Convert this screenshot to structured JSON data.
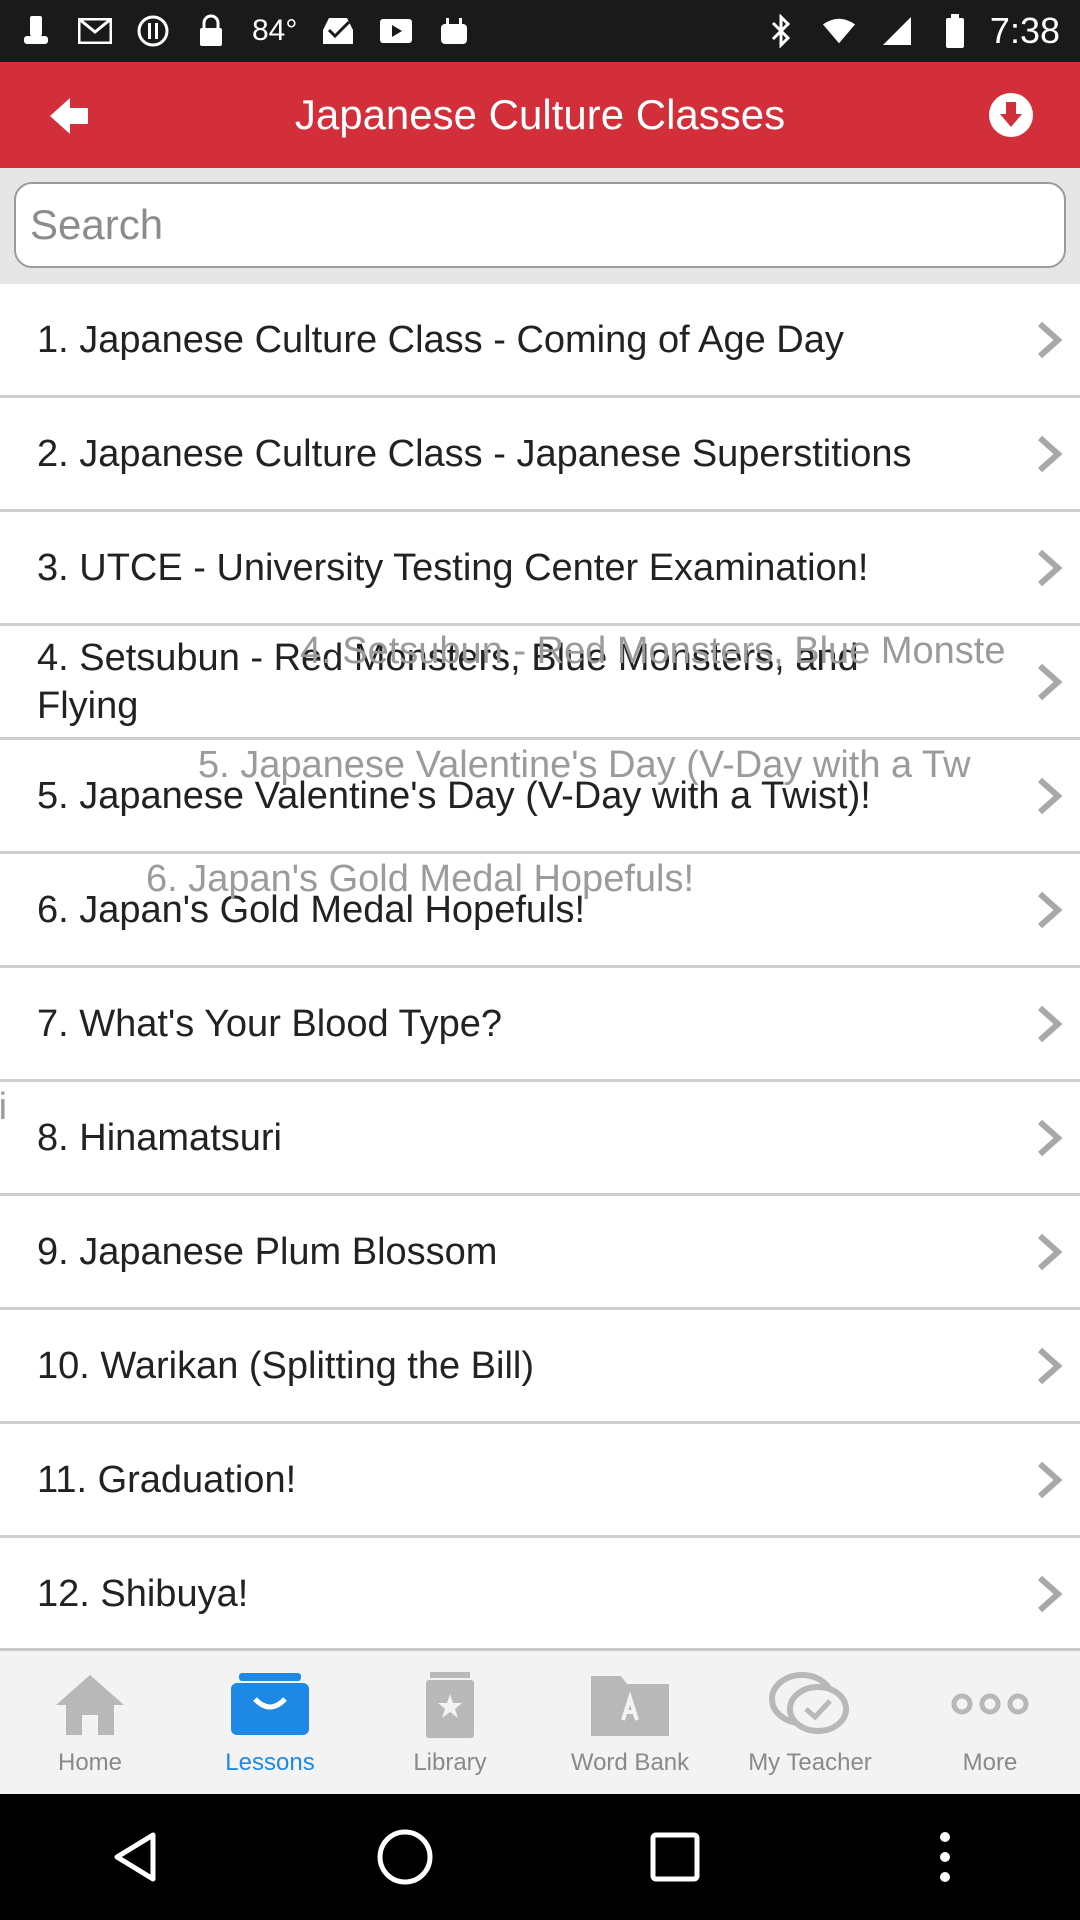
{
  "status_bar": {
    "temperature": "84°",
    "time": "7:38"
  },
  "header": {
    "title": "Japanese Culture Classes"
  },
  "search": {
    "placeholder": "Search"
  },
  "lessons": [
    {
      "label": "1. Japanese Culture Class - Coming of Age Day"
    },
    {
      "label": "2. Japanese Culture Class - Japanese Superstitions"
    },
    {
      "label": "3. UTCE - University Testing Center Examination!"
    },
    {
      "label": "4. Setsubun - Red Monsters, Blue Monsters, and Flying"
    },
    {
      "label": "5. Japanese Valentine's Day (V-Day with a Twist)!"
    },
    {
      "label": "6. Japan's Gold Medal Hopefuls!"
    },
    {
      "label": "7. What's Your Blood Type?"
    },
    {
      "label": "8. Hinamatsuri"
    },
    {
      "label": "9. Japanese Plum Blossom"
    },
    {
      "label": "10. Warikan (Splitting the Bill)"
    },
    {
      "label": "11. Graduation!"
    },
    {
      "label": "12. Shibuya!"
    }
  ],
  "ghost_text": {
    "row4": "4. Setsubun - Red Monsters, Blue Monste",
    "row5": "5. Japanese Valentine's Day (V-Day with a Tw",
    "row6": "6. Japan's Gold Medal Hopefuls!",
    "row8": "ri"
  },
  "tabs": [
    {
      "label": "Home",
      "icon": "home-icon"
    },
    {
      "label": "Lessons",
      "icon": "lessons-icon"
    },
    {
      "label": "Library",
      "icon": "library-icon"
    },
    {
      "label": "Word Bank",
      "icon": "word-bank-icon"
    },
    {
      "label": "My Teacher",
      "icon": "my-teacher-icon"
    },
    {
      "label": "More",
      "icon": "more-icon"
    }
  ],
  "active_tab": "Lessons",
  "colors": {
    "header": "#d32f3a",
    "active_tab": "#1e88e5",
    "inactive_tab": "#8a8a8a"
  }
}
